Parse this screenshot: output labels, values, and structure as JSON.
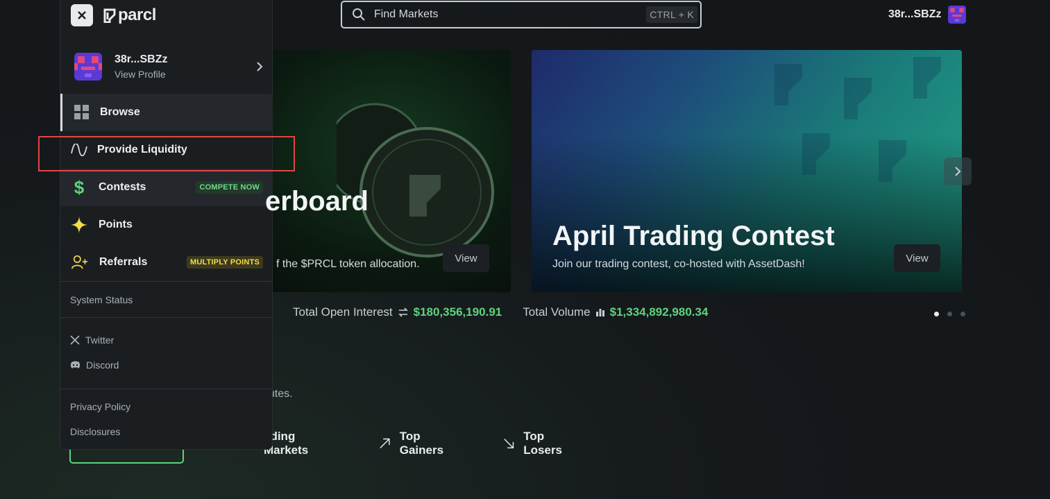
{
  "search": {
    "placeholder": "Find Markets",
    "shortcut": "CTRL + K"
  },
  "header": {
    "username": "38r...SBZz"
  },
  "banners": [
    {
      "title": "erboard",
      "subtitle": "f the $PRCL token allocation.",
      "button": "View"
    },
    {
      "title": "April Trading Contest",
      "subtitle": "Join our trading contest, co-hosted with AssetDash!",
      "button": "View"
    }
  ],
  "stats": {
    "open_interest_label": "Total Open Interest",
    "open_interest_value": "$180,356,190.91",
    "volume_label": "Total Volume",
    "volume_value": "$1,334,892,980.34"
  },
  "carousel": {
    "active": 1,
    "count": 3
  },
  "description_fragment": "nutes.",
  "tabs": [
    {
      "label": "ading Markets"
    },
    {
      "label": "Top Gainers"
    },
    {
      "label": "Top Losers"
    }
  ],
  "sidebar": {
    "logo": "parcl",
    "profile": {
      "name": "38r...SBZz",
      "link": "View Profile"
    },
    "nav": [
      {
        "label": "Browse",
        "icon": "grid-icon"
      },
      {
        "label": "Provide Liquidity",
        "icon": "wave-icon"
      },
      {
        "label": "Contests",
        "icon": "dollar-icon",
        "badge": "COMPETE NOW"
      },
      {
        "label": "Points",
        "icon": "sparkle-icon"
      },
      {
        "label": "Referrals",
        "icon": "add-user-icon",
        "badge": "MULTIPLY POINTS"
      }
    ],
    "system_status": "System Status",
    "social": [
      {
        "label": "Twitter",
        "icon": "x-logo-icon"
      },
      {
        "label": "Discord",
        "icon": "discord-icon"
      }
    ],
    "legal": [
      "Privacy Policy",
      "Disclosures"
    ]
  },
  "colors": {
    "accent_green": "#5fd37d",
    "highlight_red": "#e04646",
    "badge_yellow": "#f2dc4a"
  }
}
